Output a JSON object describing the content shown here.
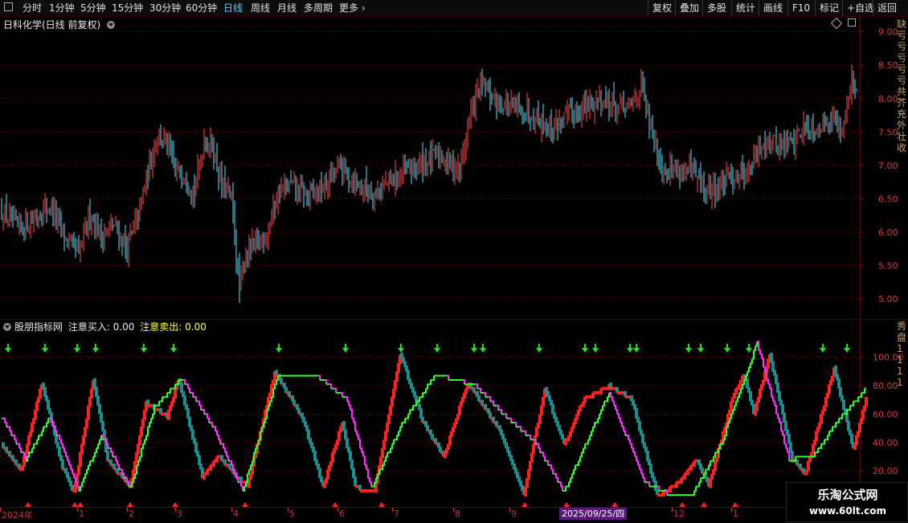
{
  "toolbar": {
    "periods": [
      "分时",
      "1分钟",
      "5分钟",
      "15分钟",
      "30分钟",
      "60分钟",
      "日线",
      "周线",
      "月线",
      "多周期",
      "更多"
    ],
    "active_period": "日线",
    "right_buttons": [
      "复权",
      "叠加",
      "多股",
      "统计",
      "画线",
      "F10",
      "标记",
      "+自选",
      "返回"
    ]
  },
  "main": {
    "title": "日科化学(日线 前复权)",
    "price_ticks": [
      "9.00",
      "8.50",
      "8.00",
      "7.50",
      "7.00",
      "6.50",
      "6.00",
      "5.50",
      "5.00"
    ],
    "price_tick_values": [
      9.0,
      8.5,
      8.0,
      7.5,
      7.0,
      6.5,
      6.0,
      5.5,
      5.0
    ],
    "price_range": [
      4.75,
      9.2
    ],
    "up_color": "#ff4a4a",
    "down_color": "#54e4ff",
    "side_text": "缺亏亏亏亏亏共芥充外壮收"
  },
  "indicator": {
    "name": "股朋指标网",
    "buy_label": "注意买入:",
    "buy_value": "0.00",
    "sell_label": "注意卖出:",
    "sell_value": "0.00",
    "ticks": [
      "100.00",
      "80.00",
      "60.00",
      "40.00",
      "20.00"
    ],
    "tick_values": [
      100,
      80,
      60,
      40,
      20
    ],
    "range": [
      -2,
      110
    ],
    "side_text": "秀盘1111"
  },
  "date_axis": {
    "labels": [
      "2024年",
      "1",
      "2",
      "3",
      "4",
      "5",
      "6",
      "7",
      "8",
      "9",
      "12",
      "1"
    ],
    "highlight": "2025/09/25/四"
  },
  "watermark": {
    "line1": "乐淘公式网",
    "line2": "www.60lt.com"
  },
  "chart_data": {
    "type": "candlestick",
    "title": "日科化学(日线 前复权)",
    "ylim": [
      4.75,
      9.2
    ],
    "y_ticks": [
      5.0,
      5.5,
      6.0,
      6.5,
      7.0,
      7.5,
      8.0,
      8.5,
      9.0
    ],
    "anchors_close": [
      [
        0,
        6.3
      ],
      [
        10,
        6.05
      ],
      [
        20,
        6.2
      ],
      [
        30,
        6.4
      ],
      [
        40,
        5.9
      ],
      [
        48,
        5.65
      ],
      [
        55,
        6.3
      ],
      [
        62,
        5.95
      ],
      [
        70,
        6.1
      ],
      [
        78,
        5.75
      ],
      [
        85,
        6.25
      ],
      [
        92,
        7.0
      ],
      [
        97,
        7.5
      ],
      [
        103,
        7.3
      ],
      [
        108,
        6.9
      ],
      [
        114,
        6.9
      ],
      [
        120,
        6.6
      ],
      [
        126,
        7.4
      ],
      [
        131,
        7.3
      ],
      [
        137,
        6.7
      ],
      [
        143,
        6.5
      ],
      [
        148,
        5.1
      ],
      [
        152,
        5.7
      ],
      [
        158,
        5.8
      ],
      [
        165,
        6.0
      ],
      [
        172,
        6.6
      ],
      [
        180,
        6.7
      ],
      [
        190,
        6.55
      ],
      [
        200,
        6.65
      ],
      [
        210,
        7.0
      ],
      [
        220,
        6.75
      ],
      [
        232,
        6.6
      ],
      [
        245,
        6.8
      ],
      [
        258,
        7.0
      ],
      [
        272,
        7.15
      ],
      [
        285,
        6.95
      ],
      [
        292,
        7.8
      ],
      [
        298,
        8.2
      ],
      [
        306,
        8.0
      ],
      [
        318,
        7.85
      ],
      [
        330,
        7.8
      ],
      [
        342,
        7.55
      ],
      [
        352,
        7.75
      ],
      [
        362,
        7.85
      ],
      [
        372,
        8.0
      ],
      [
        382,
        7.9
      ],
      [
        390,
        7.85
      ],
      [
        398,
        8.2
      ],
      [
        404,
        7.5
      ],
      [
        412,
        6.95
      ],
      [
        420,
        6.95
      ],
      [
        430,
        6.9
      ],
      [
        438,
        6.6
      ],
      [
        447,
        6.7
      ],
      [
        455,
        6.85
      ],
      [
        465,
        6.95
      ],
      [
        475,
        7.4
      ],
      [
        484,
        7.3
      ],
      [
        492,
        7.35
      ],
      [
        500,
        7.6
      ],
      [
        508,
        7.55
      ],
      [
        516,
        7.75
      ],
      [
        523,
        7.55
      ],
      [
        529,
        8.3
      ],
      [
        532,
        8.0
      ]
    ],
    "indicator_lines": [
      {
        "name": "red/teal fast line",
        "colors": [
          "#ff2020",
          "#1a8f8f"
        ],
        "anchors": [
          [
            0,
            38
          ],
          [
            12,
            20
          ],
          [
            25,
            82
          ],
          [
            38,
            22
          ],
          [
            45,
            5
          ],
          [
            57,
            85
          ],
          [
            66,
            28
          ],
          [
            80,
            8
          ],
          [
            90,
            68
          ],
          [
            103,
            58
          ],
          [
            110,
            85
          ],
          [
            125,
            15
          ],
          [
            135,
            30
          ],
          [
            148,
            14
          ],
          [
            153,
            10
          ],
          [
            170,
            90
          ],
          [
            188,
            55
          ],
          [
            200,
            8
          ],
          [
            212,
            55
          ],
          [
            220,
            8
          ],
          [
            232,
            5
          ],
          [
            248,
            102
          ],
          [
            262,
            55
          ],
          [
            275,
            30
          ],
          [
            290,
            82
          ],
          [
            310,
            48
          ],
          [
            325,
            4
          ],
          [
            338,
            78
          ],
          [
            350,
            38
          ],
          [
            362,
            70
          ],
          [
            378,
            80
          ],
          [
            392,
            70
          ],
          [
            408,
            2
          ],
          [
            422,
            12
          ],
          [
            432,
            28
          ],
          [
            440,
            10
          ],
          [
            455,
            72
          ],
          [
            462,
            88
          ],
          [
            468,
            60
          ],
          [
            478,
            102
          ],
          [
            492,
            28
          ],
          [
            500,
            18
          ],
          [
            518,
            92
          ],
          [
            530,
            35
          ],
          [
            538,
            72
          ]
        ]
      },
      {
        "name": "green/magenta slow line",
        "colors": [
          "#30ff30",
          "#ff30ff"
        ],
        "anchors": [
          [
            0,
            58
          ],
          [
            15,
            28
          ],
          [
            30,
            58
          ],
          [
            48,
            6
          ],
          [
            62,
            45
          ],
          [
            80,
            8
          ],
          [
            95,
            65
          ],
          [
            112,
            85
          ],
          [
            132,
            50
          ],
          [
            150,
            6
          ],
          [
            172,
            88
          ],
          [
            195,
            88
          ],
          [
            215,
            70
          ],
          [
            230,
            8
          ],
          [
            250,
            55
          ],
          [
            270,
            88
          ],
          [
            295,
            80
          ],
          [
            312,
            60
          ],
          [
            332,
            40
          ],
          [
            350,
            5
          ],
          [
            368,
            50
          ],
          [
            378,
            75
          ],
          [
            400,
            12
          ],
          [
            418,
            2
          ],
          [
            430,
            4
          ],
          [
            448,
            40
          ],
          [
            470,
            110
          ],
          [
            490,
            28
          ],
          [
            505,
            30
          ],
          [
            520,
            55
          ],
          [
            538,
            78
          ]
        ]
      }
    ]
  }
}
